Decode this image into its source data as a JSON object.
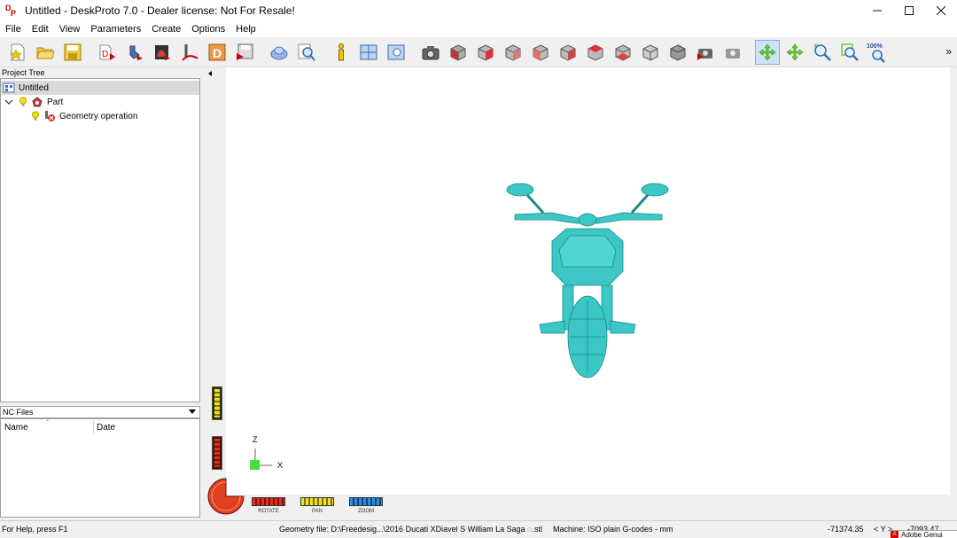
{
  "window": {
    "title": "Untitled - DeskProto 7.0 - Dealer license: Not For Resale!"
  },
  "menu": [
    "File",
    "Edit",
    "View",
    "Parameters",
    "Create",
    "Options",
    "Help"
  ],
  "toolbar": {
    "zoom_level": "100%"
  },
  "project_tree": {
    "header": "Project Tree",
    "items": [
      {
        "label": "Untitled",
        "level": 0,
        "icon": "project-icon",
        "selected": true
      },
      {
        "label": "Part",
        "level": 1,
        "icon": "part-icon",
        "selected": false
      },
      {
        "label": "Geometry operation",
        "level": 2,
        "icon": "geometry-operation-icon",
        "selected": false
      }
    ]
  },
  "nc_files": {
    "header": "NC Files",
    "columns": [
      "Name",
      "Date"
    ]
  },
  "viewport": {
    "model_color": "#3cc6c6",
    "axis_z": "Z",
    "axis_x": "X",
    "controls": [
      "ROTATE",
      "PAN",
      "ZOOM"
    ]
  },
  "status": {
    "help": "For Help, press F1",
    "geometry_file": "Geometry file: D:\\Freedesig...\\2016 Ducati XDiavel S William La Saga ◌.stl",
    "machine": "Machine: ISO plain G-codes - mm",
    "coord_x": "-71374.35",
    "coord_y_label": "< Y >",
    "coord_y": "-7093.47"
  },
  "taskbar": {
    "adobe_label": "Adobe Genui"
  }
}
